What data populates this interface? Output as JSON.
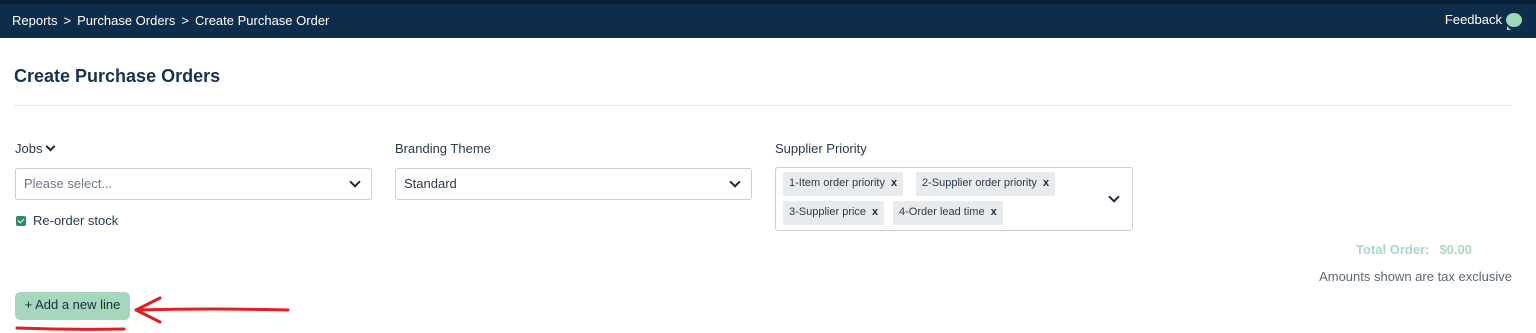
{
  "header": {
    "breadcrumb": [
      "Reports",
      "Purchase Orders",
      "Create Purchase Order"
    ],
    "breadcrumb_separator": ">",
    "feedback_label": "Feedback",
    "feedback_icon": "chat-bubble-icon"
  },
  "page": {
    "title": "Create Purchase Orders"
  },
  "form": {
    "jobs": {
      "label": "Jobs",
      "placeholder": "Please select...",
      "label_icon": "chevron-down-icon"
    },
    "branding_theme": {
      "label": "Branding Theme",
      "value": "Standard"
    },
    "supplier_priority": {
      "label": "Supplier Priority",
      "tags": [
        "1-Item order priority",
        "2-Supplier order priority",
        "3-Supplier price",
        "4-Order lead time"
      ],
      "remove_glyph": "x"
    },
    "reorder_stock": {
      "label": "Re-order stock",
      "checked": true
    }
  },
  "summary": {
    "total_label": "Total Order:",
    "total_value": "$0.00",
    "tax_note": "Amounts shown are tax exclusive"
  },
  "actions": {
    "add_line_label": "+ Add a new line"
  },
  "colors": {
    "header_bg": "#0f2d4a",
    "accent_green": "#a6d7bc",
    "checkbox_green": "#2f8a63",
    "annotation_red": "#e02020"
  }
}
